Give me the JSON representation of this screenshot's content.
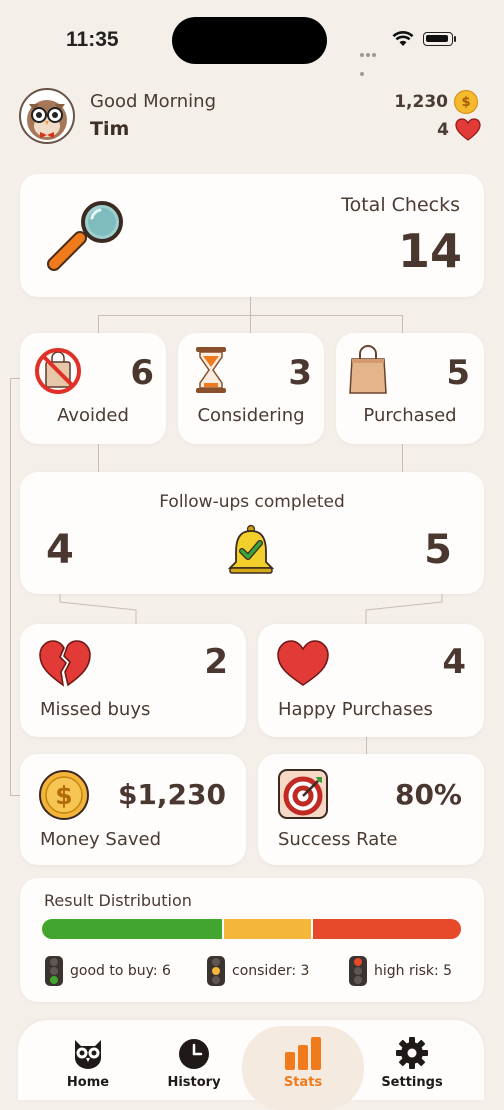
{
  "status_bar": {
    "time": "11:35"
  },
  "header": {
    "greeting": "Good Morning",
    "username": "Tim",
    "coins": "1,230",
    "hearts": "4"
  },
  "total_checks": {
    "label": "Total Checks",
    "value": "14"
  },
  "outcomes": [
    {
      "label": "Avoided",
      "value": "6",
      "icon": "no-shopping-bag-icon"
    },
    {
      "label": "Considering",
      "value": "3",
      "icon": "hourglass-icon"
    },
    {
      "label": "Purchased",
      "value": "5",
      "icon": "shopping-bag-icon"
    }
  ],
  "followups": {
    "label": "Follow-ups completed",
    "left_value": "4",
    "right_value": "5"
  },
  "missed_buys": {
    "label": "Missed buys",
    "value": "2"
  },
  "happy_purchases": {
    "label": "Happy Purchases",
    "value": "4"
  },
  "money_saved": {
    "label": "Money Saved",
    "value": "$1,230"
  },
  "success_rate": {
    "label": "Success Rate",
    "value": "80%"
  },
  "distribution": {
    "title": "Result Distribution",
    "segments": [
      {
        "label": "good to buy: 6",
        "count": 6,
        "color": "#42a52e"
      },
      {
        "label": "consider: 3",
        "count": 3,
        "color": "#f4b73a"
      },
      {
        "label": "high risk: 5",
        "count": 5,
        "color": "#e64a2a"
      }
    ]
  },
  "nav": {
    "items": [
      {
        "label": "Home",
        "icon": "owl-icon"
      },
      {
        "label": "History",
        "icon": "clock-icon"
      },
      {
        "label": "Stats",
        "icon": "bar-chart-icon",
        "active": true
      },
      {
        "label": "Settings",
        "icon": "gear-icon"
      }
    ]
  },
  "colors": {
    "background": "#f4efe9",
    "card": "#fffdfb",
    "accent_orange": "#f07b1d",
    "text_brown": "#4a3b33"
  }
}
